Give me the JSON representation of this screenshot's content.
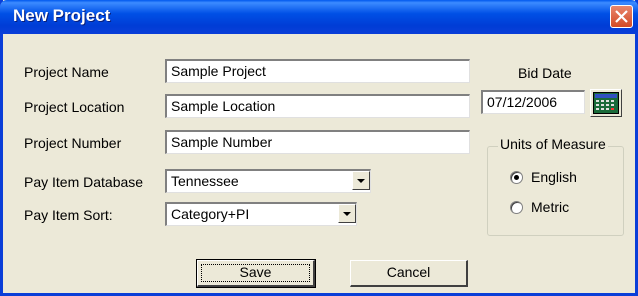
{
  "window": {
    "title": "New Project",
    "close_icon": "close-icon"
  },
  "fields": {
    "project_name": {
      "label": "Project Name",
      "value": "Sample Project"
    },
    "project_location": {
      "label": "Project Location",
      "value": "Sample Location"
    },
    "project_number": {
      "label": "Project Number",
      "value": "Sample Number"
    },
    "pay_item_database": {
      "label": "Pay Item Database",
      "value": "Tennessee"
    },
    "pay_item_sort": {
      "label": "Pay Item Sort:",
      "value": "Category+PI"
    }
  },
  "bid_date": {
    "label": "Bid Date",
    "value": "07/12/2006",
    "icon": "calendar-icon"
  },
  "units": {
    "legend": "Units of Measure",
    "options": [
      {
        "label": "English",
        "checked": true
      },
      {
        "label": "Metric",
        "checked": false
      }
    ]
  },
  "buttons": {
    "save": "Save",
    "cancel": "Cancel"
  },
  "colors": {
    "titlebar": "#0a3ed8",
    "close": "#d24a25",
    "dialog_bg": "#ece9d8"
  }
}
